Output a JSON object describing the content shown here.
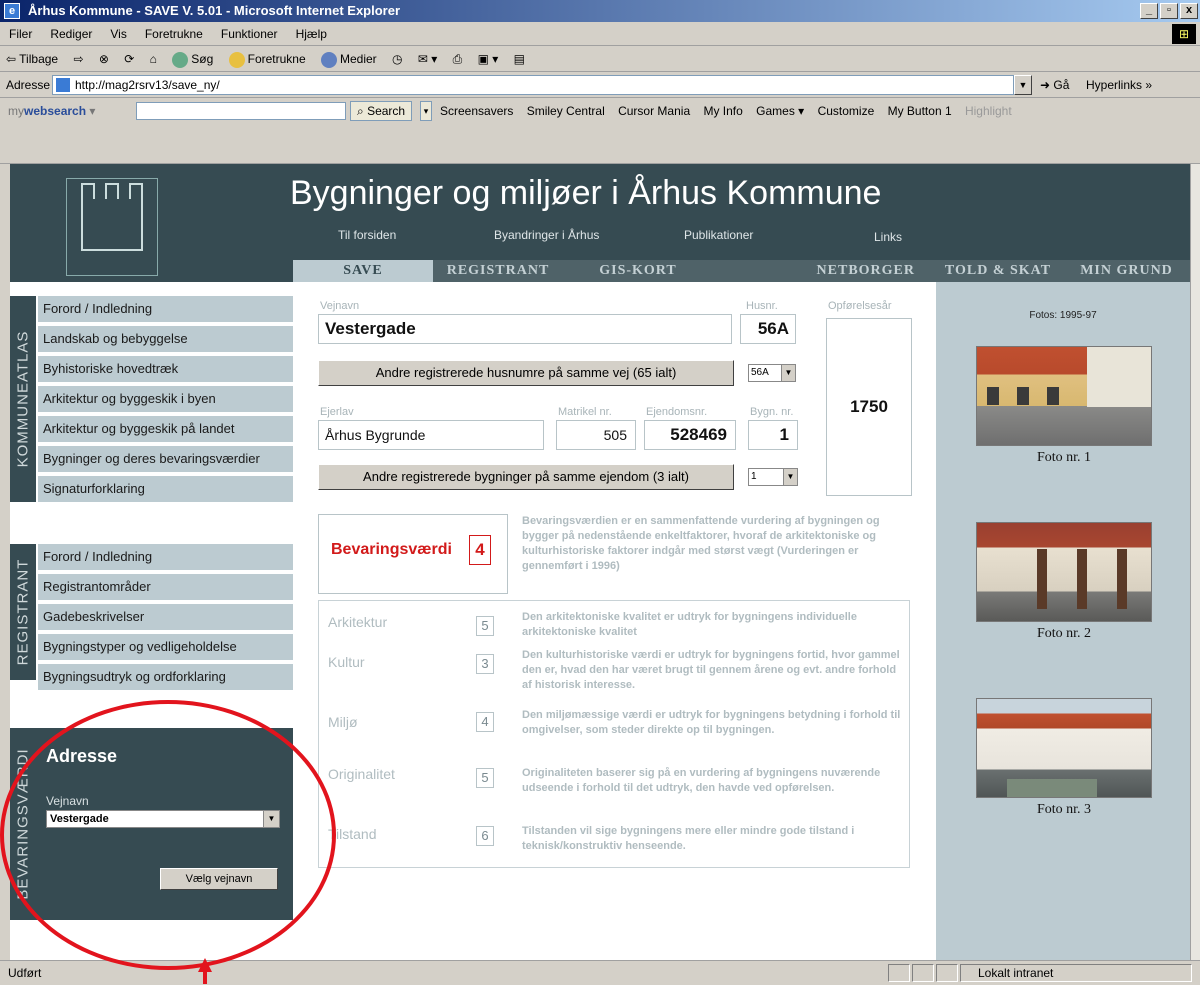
{
  "window": {
    "title": "Århus Kommune - SAVE V. 5.01 - Microsoft Internet Explorer",
    "buttons": [
      "_",
      "▫",
      "x"
    ]
  },
  "menu": [
    "Filer",
    "Rediger",
    "Vis",
    "Foretrukne",
    "Funktioner",
    "Hjælp"
  ],
  "toolbar": {
    "back": "⇦ Tilbage",
    "forward": "⇨",
    "search": "Søg",
    "favorites": "Foretrukne",
    "media": "Medier"
  },
  "address": {
    "label": "Adresse",
    "url": "http://mag2rsrv13/save_ny/",
    "go": "Gå",
    "hyperlinks": "Hyperlinks »"
  },
  "searchbar": {
    "brand_prefix": "my",
    "brand_bold": "web",
    "brand_suffix": "search ▾",
    "button": "Search",
    "links": [
      "Screensavers",
      "Smiley Central",
      "Cursor Mania",
      "My Info",
      "Games ▾",
      "Customize",
      "My Button 1",
      "Highlight"
    ]
  },
  "site": {
    "title": "Bygninger og miljøer i Århus Kommune",
    "nav": [
      "Til forsiden",
      "Byandringer i Århus",
      "Publikationer",
      "Links"
    ],
    "tabs": [
      "SAVE",
      "REGISTRANT",
      "GIS-KORT",
      "NETBORGER",
      "TOLD & SKAT",
      "MIN GRUND"
    ]
  },
  "sidebar": {
    "section1_label": "KOMMUNEATLAS",
    "section1_items": [
      "Forord / Indledning",
      "Landskab og bebyggelse",
      "Byhistoriske hovedtræk",
      "Arkitektur og byggeskik i byen",
      "Arkitektur og byggeskik på landet",
      "Bygninger og deres bevaringsværdier",
      "Signaturforklaring"
    ],
    "section2_label": "REGISTRANT",
    "section2_items": [
      "Forord / Indledning",
      "Registrantområder",
      "Gadebeskrivelser",
      "Bygningstyper og vedligeholdelse",
      "Bygningsudtryk og ordforklaring"
    ],
    "section3_label": "BEVARINGSVÆRDI",
    "address_panel": {
      "title": "Adresse",
      "street_label": "Vejnavn",
      "street_value": "Vestergade",
      "button": "Vælg vejnavn"
    }
  },
  "form": {
    "street_label": "Vejnavn",
    "street_value": "Vestergade",
    "house_label": "Husnr.",
    "house_value": "56A",
    "year_label": "Opførelsesår",
    "year_value": "1750",
    "other_numbers_button": "Andre registrerede husnumre på samme vej (65 ialt)",
    "house_select": "56A",
    "owner_label": "Ejerlav",
    "owner_value": "Århus Bygrunde",
    "matrikel_label": "Matrikel nr.",
    "matrikel_value": "505",
    "property_label": "Ejendomsnr.",
    "property_value": "528469",
    "building_label": "Bygn. nr.",
    "building_value": "1",
    "other_buildings_button": "Andre registrerede bygninger på samme ejendom (3 ialt)",
    "building_select": "1",
    "value_label": "Bevaringsværdi",
    "value_number": "4",
    "value_desc": "Bevaringsværdien er en sammenfattende vurdering af bygningen og bygger på nedenstående enkeltfaktorer, hvoraf de arkitektoniske og kulturhistoriske faktorer indgår med størst vægt (Vurderingen er gennemført i 1996)",
    "ratings": [
      {
        "label": "Arkitektur",
        "value": "5",
        "desc": "Den arkitektoniske kvalitet er udtryk for bygningens individuelle arkitektoniske kvalitet"
      },
      {
        "label": "Kultur",
        "value": "3",
        "desc": "Den kulturhistoriske værdi er udtryk for bygningens fortid, hvor gammel den er, hvad den har været brugt til gennem årene og evt. andre forhold af historisk interesse."
      },
      {
        "label": "Miljø",
        "value": "4",
        "desc": "Den miljømæssige værdi er udtryk for bygningens betydning i forhold til omgivelser, som steder direkte op til bygningen."
      },
      {
        "label": "Originalitet",
        "value": "5",
        "desc": "Originaliteten baserer sig på en vurdering af bygningens nuværende udseende i forhold til det udtryk, den havde ved opførelsen."
      },
      {
        "label": "Tilstand",
        "value": "6",
        "desc": "Tilstanden vil sige bygningens mere eller mindre gode tilstand i teknisk/konstruktiv henseende."
      }
    ]
  },
  "photos": {
    "header": "Fotos: 1995-97",
    "captions": [
      "Foto nr. 1",
      "Foto nr. 2",
      "Foto nr. 3"
    ]
  },
  "status": {
    "text": "Udført",
    "zone": "Lokalt intranet"
  },
  "colors": {
    "header_bg": "#364b52",
    "nav_light": "#bccbd1",
    "accent_red": "#e2141d"
  }
}
